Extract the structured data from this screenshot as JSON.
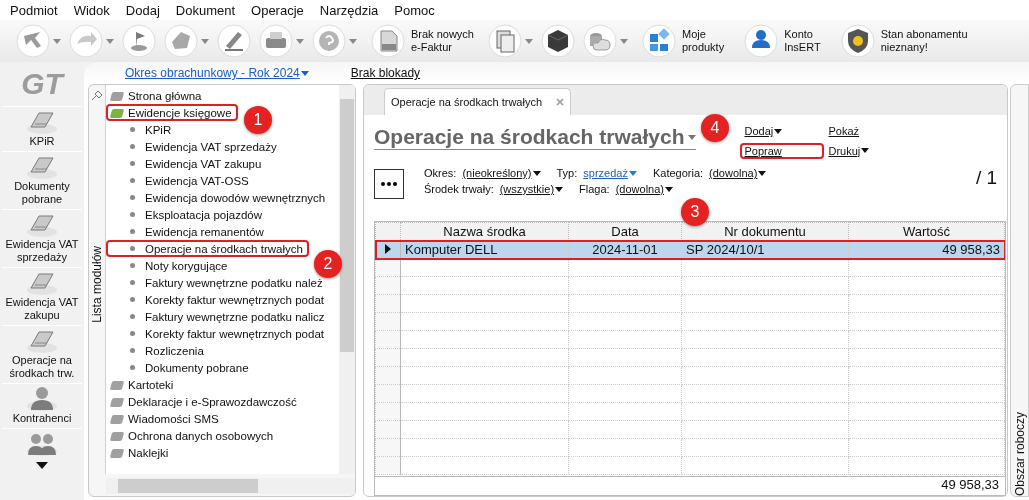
{
  "menu": [
    "Podmiot",
    "Widok",
    "Dodaj",
    "Dokument",
    "Operacje",
    "Narzędzia",
    "Pomoc"
  ],
  "toolbar": [
    {
      "dropdown": true
    },
    {
      "dropdown": true
    },
    {
      "dropdown": false
    },
    {
      "dropdown": true
    },
    {
      "dropdown": false
    },
    {
      "dropdown": true
    },
    {
      "dropdown": true
    },
    {
      "label": "Brak nowych\ne-Faktur",
      "dropdown": false
    },
    {
      "dropdown": true
    },
    {
      "dropdown": false
    },
    {
      "dropdown": true
    },
    {
      "label": "Moje\nprodukty",
      "dropdown": false
    },
    {
      "label": "Konto\nInsERT",
      "dropdown": false
    },
    {
      "label": "Stan abonamentu\nnieznany!",
      "dropdown": false
    }
  ],
  "logo": "GT",
  "nav": [
    {
      "label": "KPiR"
    },
    {
      "label": "Dokumenty pobrane"
    },
    {
      "label": "Ewidencja VAT sprzedaży"
    },
    {
      "label": "Ewidencja VAT zakupu"
    },
    {
      "label": "Operacje na środkach trw."
    },
    {
      "label": "Kontrahenci"
    }
  ],
  "period_link": "Okres obrachunkowy - Rok 2024",
  "lock_link": "Brak blokady",
  "tree": {
    "title": "Lista modułów",
    "items": [
      {
        "label": "Strona główna",
        "highlighted": false
      },
      {
        "label": "Ewidencje księgowe",
        "highlighted": true,
        "children": [
          {
            "label": "KPiR",
            "highlighted": false
          },
          {
            "label": "Ewidencja VAT sprzedaży",
            "highlighted": false
          },
          {
            "label": "Ewidencja VAT zakupu",
            "highlighted": false
          },
          {
            "label": "Ewidencja VAT-OSS",
            "highlighted": false
          },
          {
            "label": "Ewidencja dowodów wewnętrznych",
            "highlighted": false
          },
          {
            "label": "Eksploatacja pojazdów",
            "highlighted": false
          },
          {
            "label": "Ewidencja remanentów",
            "highlighted": false
          },
          {
            "label": "Operacje na środkach trwałych",
            "highlighted": true
          },
          {
            "label": "Noty korygujące",
            "highlighted": false
          },
          {
            "label": "Faktury wewnętrzne podatku należ",
            "highlighted": false
          },
          {
            "label": "Korekty faktur wewnętrznych podat",
            "highlighted": false
          },
          {
            "label": "Faktury wewnętrzne podatku nalicz",
            "highlighted": false
          },
          {
            "label": "Korekty faktur wewnętrznych podat",
            "highlighted": false
          },
          {
            "label": "Rozliczenia",
            "highlighted": false
          },
          {
            "label": "Dokumenty pobrane",
            "highlighted": false
          }
        ]
      },
      {
        "label": "Kartoteki",
        "highlighted": false
      },
      {
        "label": "Deklaracje i e-Sprawozdawczość",
        "highlighted": false
      },
      {
        "label": "Wiadomości SMS",
        "highlighted": false
      },
      {
        "label": "Ochrona danych osobowych",
        "highlighted": false
      },
      {
        "label": "Naklejki",
        "highlighted": false
      }
    ]
  },
  "tab": {
    "label": "Operacje na środkach trwałych"
  },
  "title": "Operacje na środkach trwałych",
  "actions": [
    {
      "label": "Dodaj",
      "dropdown": true,
      "highlighted": false
    },
    {
      "label": "Popraw",
      "dropdown": false,
      "highlighted": true
    },
    {
      "label": "Pokaż",
      "dropdown": false,
      "highlighted": false
    },
    {
      "label": "Drukuj",
      "dropdown": true,
      "highlighted": false
    }
  ],
  "filters": [
    {
      "label": "Okres:",
      "value": "(nieokreślony)",
      "active": false
    },
    {
      "label": "Typ:",
      "value": "sprzedaż",
      "active": true
    },
    {
      "label": "Kategoria:",
      "value": "(dowolna)",
      "active": false
    },
    {
      "label": "Środek trwały:",
      "value": "(wszystkie)",
      "active": false
    },
    {
      "label": "Flaga:",
      "value": "(dowolna)",
      "active": false
    }
  ],
  "page_count": "/ 1",
  "table": {
    "columns": [
      "Nazwa środka",
      "Data",
      "Nr dokumentu",
      "Wartość"
    ],
    "rows": [
      {
        "cells": [
          "Komputer DELL",
          "2024-11-01",
          "SP 2024/10/1",
          "49 958,33"
        ],
        "selected": true,
        "highlighted": true
      }
    ],
    "total": "49 958,33"
  },
  "right_strip": "Obszar roboczy",
  "callouts": [
    {
      "label": "1"
    },
    {
      "label": "2"
    },
    {
      "label": "3"
    },
    {
      "label": "4"
    }
  ]
}
